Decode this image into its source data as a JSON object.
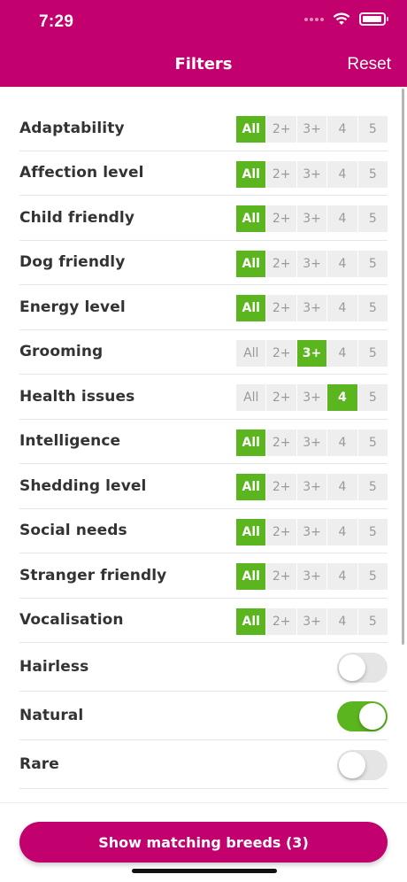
{
  "status_bar": {
    "time": "7:29"
  },
  "header": {
    "title": "Filters",
    "reset_label": "Reset"
  },
  "colors": {
    "brand": "#C2006E",
    "accent": "#5BB51E"
  },
  "segment_options": [
    "All",
    "2+",
    "3+",
    "4",
    "5"
  ],
  "rating_filters": [
    {
      "label": "Adaptability",
      "selected": "All"
    },
    {
      "label": "Affection level",
      "selected": "All"
    },
    {
      "label": "Child friendly",
      "selected": "All"
    },
    {
      "label": "Dog friendly",
      "selected": "All"
    },
    {
      "label": "Energy level",
      "selected": "All"
    },
    {
      "label": "Grooming",
      "selected": "3+"
    },
    {
      "label": "Health issues",
      "selected": "4"
    },
    {
      "label": "Intelligence",
      "selected": "All"
    },
    {
      "label": "Shedding level",
      "selected": "All"
    },
    {
      "label": "Social needs",
      "selected": "All"
    },
    {
      "label": "Stranger friendly",
      "selected": "All"
    },
    {
      "label": "Vocalisation",
      "selected": "All"
    }
  ],
  "toggle_filters": [
    {
      "label": "Hairless",
      "on": false
    },
    {
      "label": "Natural",
      "on": true
    },
    {
      "label": "Rare",
      "on": false
    }
  ],
  "cta": {
    "label": "Show matching breeds (3)"
  }
}
